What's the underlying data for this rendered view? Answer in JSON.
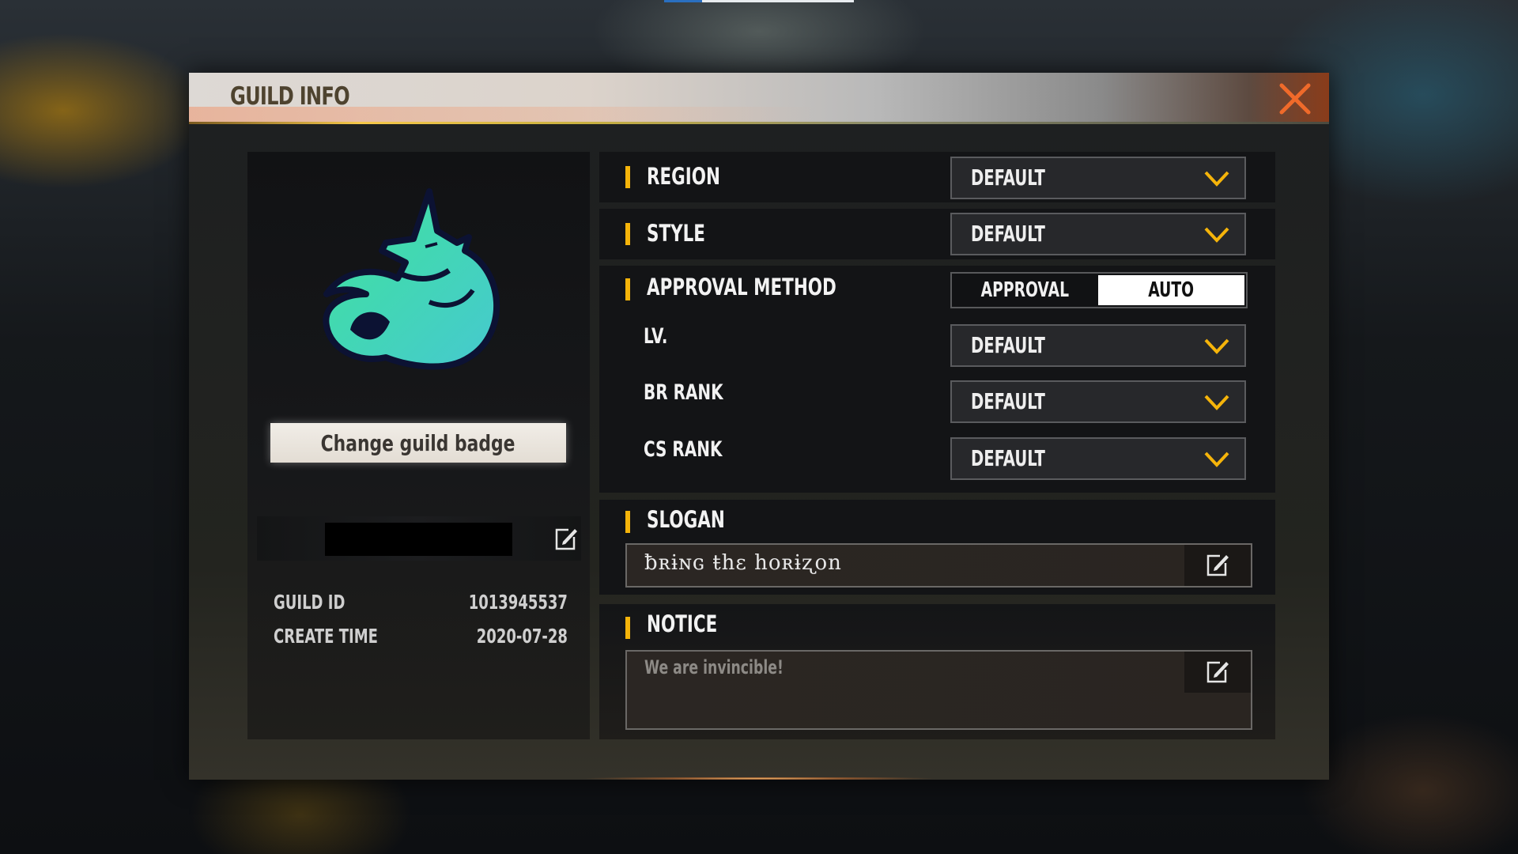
{
  "dialog": {
    "title": "GUILD INFO",
    "close_icon": "close-x-icon",
    "accent_color": "#f5b40a",
    "close_color": "#f06a2a"
  },
  "left": {
    "badge_icon": "wolf-dragon-badge",
    "badge_colors": [
      "#3ee0a8",
      "#4bd3c6"
    ],
    "change_badge_label": "Change guild badge",
    "guild_name": "",
    "guild_name_redacted": true,
    "name_edit_icon": "edit-icon",
    "info": [
      {
        "label": "GUILD ID",
        "value": "1013945537"
      },
      {
        "label": "CREATE TIME",
        "value": "2020-07-28"
      }
    ]
  },
  "right": {
    "region": {
      "label": "REGION",
      "value": "DEFAULT"
    },
    "style": {
      "label": "STYLE",
      "value": "DEFAULT"
    },
    "approval": {
      "label": "APPROVAL METHOD",
      "options": [
        "APPROVAL",
        "AUTO"
      ],
      "selected": "AUTO"
    },
    "requirements": [
      {
        "label": "LV.",
        "value": "DEFAULT"
      },
      {
        "label": "BR RANK",
        "value": "DEFAULT"
      },
      {
        "label": "CS RANK",
        "value": "DEFAULT"
      }
    ],
    "slogan": {
      "label": "SLOGAN",
      "value": "ƀʀɨɴɢ ŧhɛ hoʀɨʐon"
    },
    "notice": {
      "label": "NOTICE",
      "value": "We are invincible!"
    }
  }
}
